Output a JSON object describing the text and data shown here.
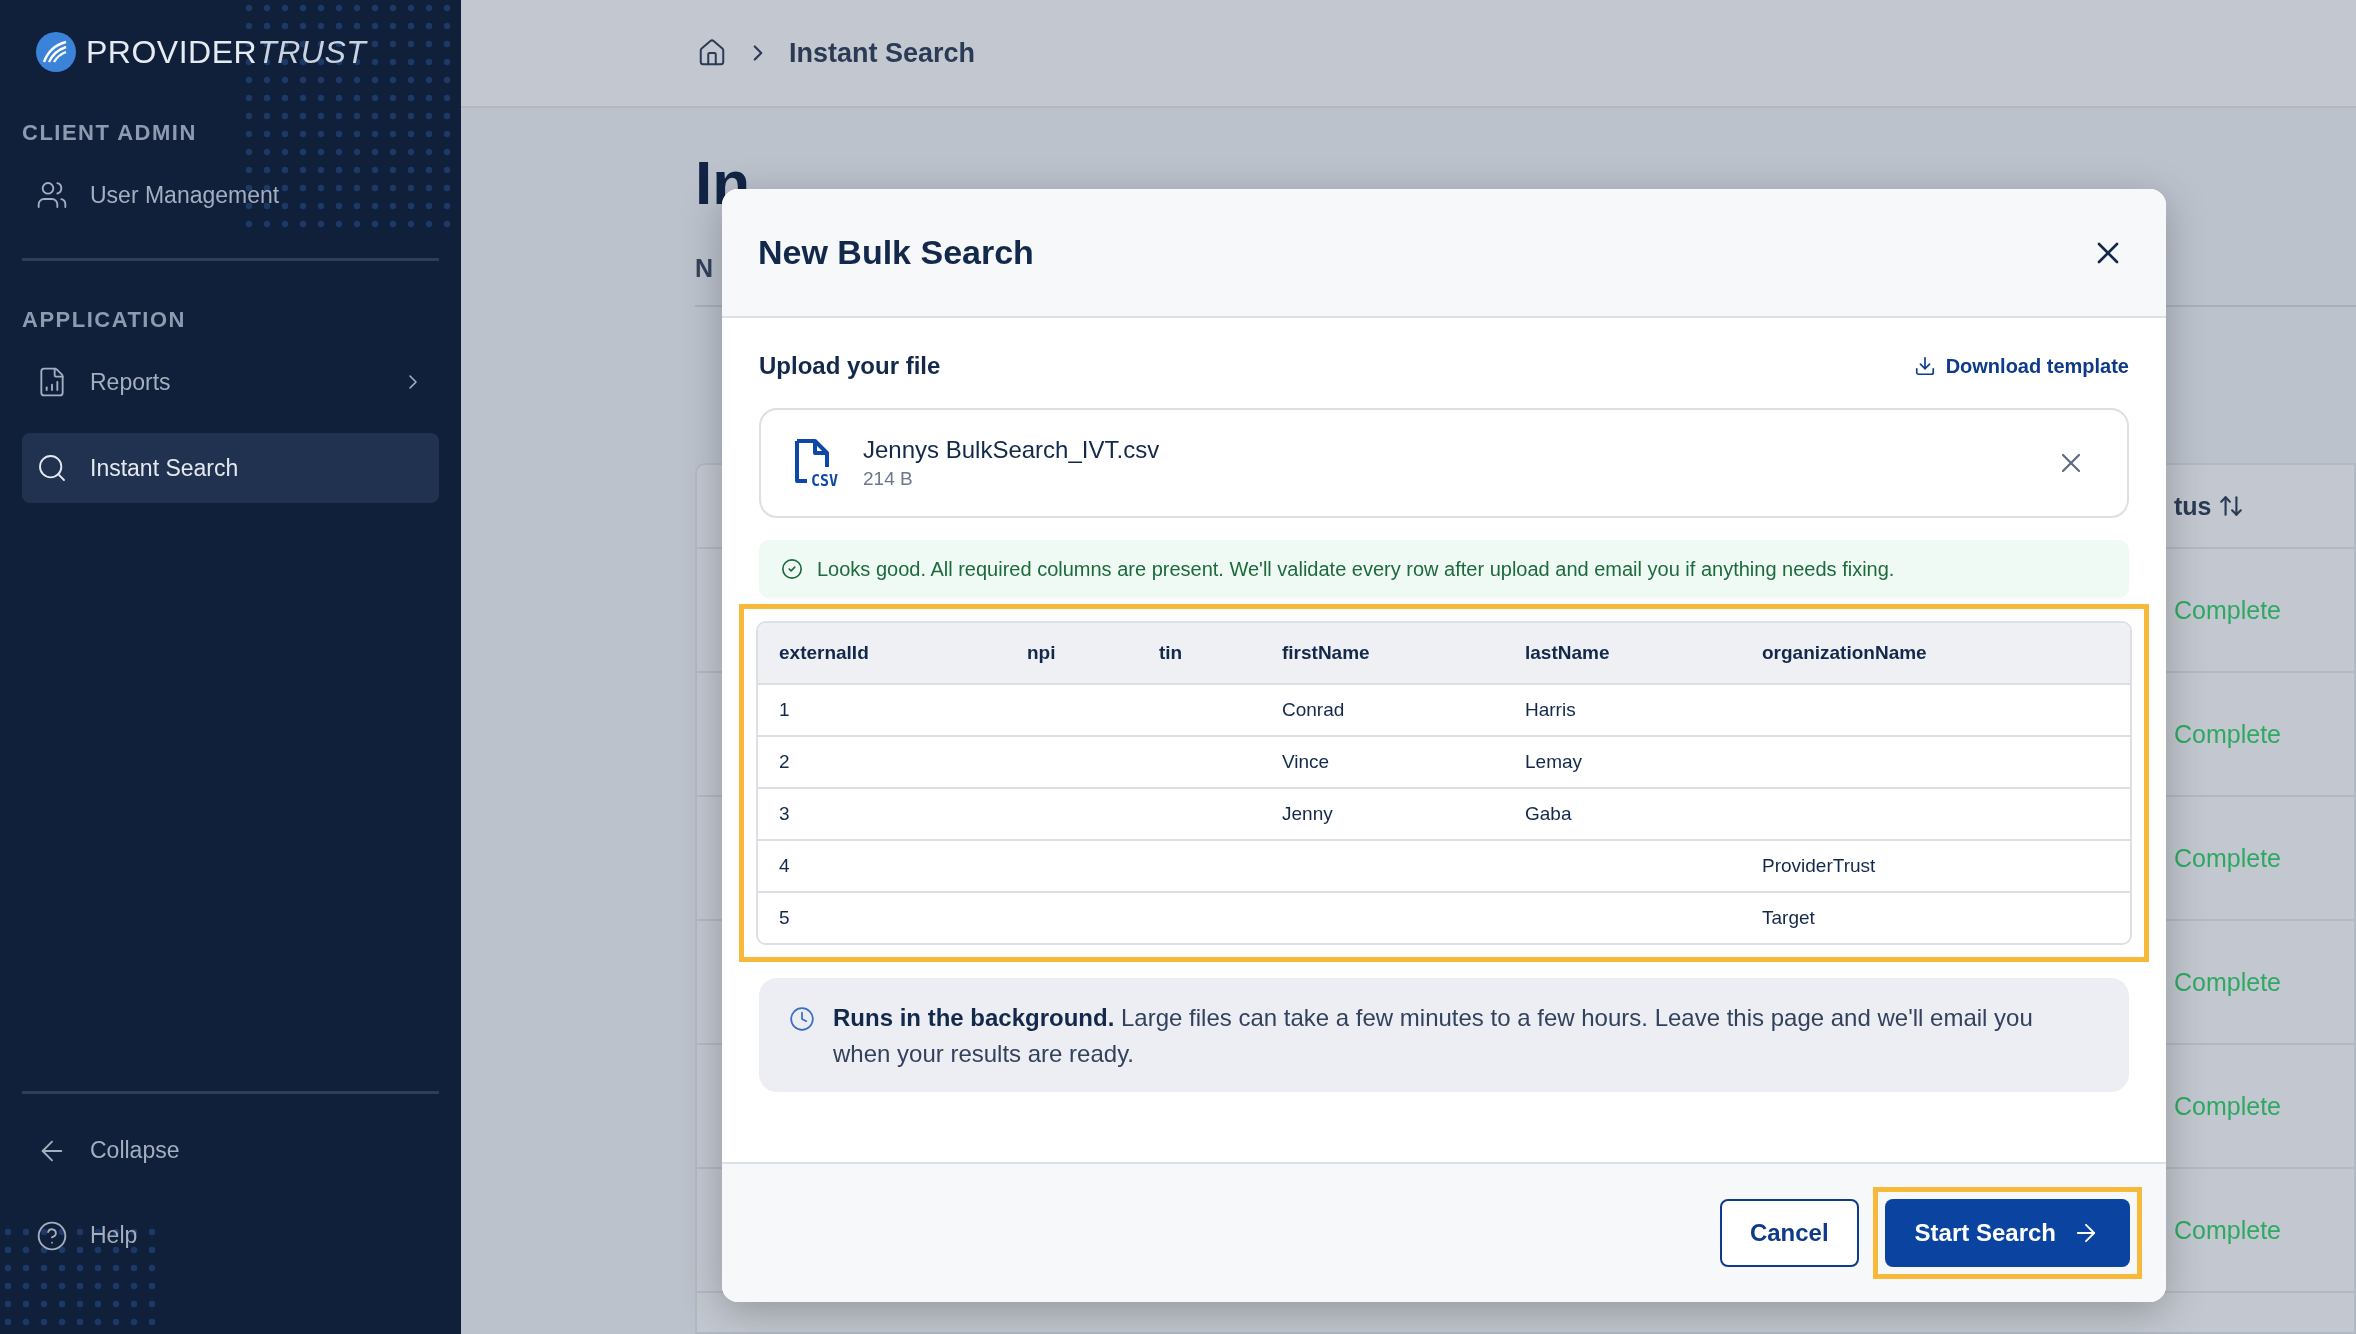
{
  "sidebar": {
    "logo": {
      "main": "PROVIDER",
      "accent": "TRUST"
    },
    "sections": [
      {
        "label": "CLIENT ADMIN",
        "items": [
          {
            "label": "User Management",
            "selected": false,
            "has_submenu": false
          }
        ]
      },
      {
        "label": "APPLICATION",
        "items": [
          {
            "label": "Reports",
            "selected": false,
            "has_submenu": true
          },
          {
            "label": "Instant Search",
            "selected": true,
            "has_submenu": false
          }
        ]
      }
    ],
    "footer_items": [
      {
        "label": "Collapse"
      },
      {
        "label": "Help"
      }
    ]
  },
  "breadcrumb": {
    "current": "Instant Search"
  },
  "page": {
    "heading": "In",
    "tab": "N",
    "table": {
      "column_header": "tus",
      "rows": [
        "Complete",
        "Complete",
        "Complete",
        "Complete",
        "Complete",
        "Complete"
      ]
    }
  },
  "modal": {
    "title": "New Bulk Search",
    "upload_label": "Upload your file",
    "download_link": "Download template",
    "file": {
      "type_label": "CSV",
      "name": "Jennys BulkSearch_IVT.csv",
      "size": "214 B"
    },
    "validation": {
      "message": "Looks good. All required columns are present. We'll validate every row after upload and email you if anything needs fixing."
    },
    "preview": {
      "highlighted": true,
      "columns": [
        "externalId",
        "npi",
        "tin",
        "firstName",
        "lastName",
        "organizationName"
      ],
      "rows": [
        [
          "1",
          null,
          null,
          "Conrad",
          "Harris",
          null
        ],
        [
          "2",
          null,
          null,
          "Vince",
          "Lemay",
          null
        ],
        [
          "3",
          null,
          null,
          "Jenny",
          "Gaba",
          null
        ],
        [
          "4",
          null,
          null,
          null,
          null,
          "ProviderTrust"
        ],
        [
          "5",
          null,
          null,
          null,
          null,
          "Target"
        ]
      ]
    },
    "notice": "**Runs in the background.** Large files can take a few minutes to a few hours. Leave this page and we'll email you when your results are ready.",
    "buttons": [
      {
        "label": "Cancel",
        "kind": "secondary",
        "highlighted": false
      },
      {
        "label": "Start Search",
        "kind": "primary",
        "highlighted": true
      }
    ]
  }
}
